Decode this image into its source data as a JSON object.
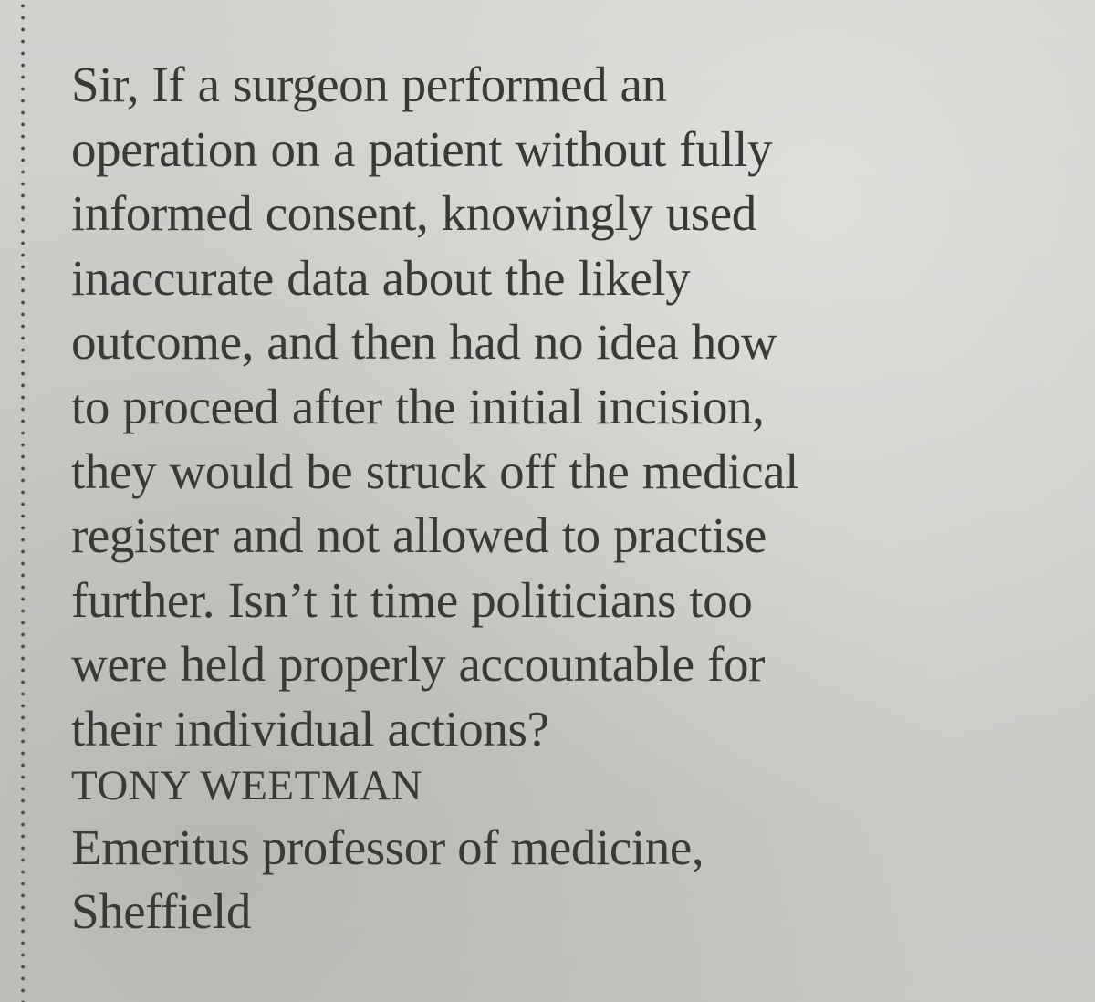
{
  "letter": {
    "lines": [
      "Sir, If a surgeon performed an",
      "operation on a patient without fully",
      "informed consent, knowingly used",
      "inaccurate data about the likely",
      "outcome, and then had no idea how",
      "to proceed after the initial incision,",
      "they would be struck off the medical",
      "register and not allowed to practise",
      "further. Isn’t it time politicians too",
      "were held properly accountable for",
      "their individual actions?"
    ]
  },
  "signature": {
    "name": "TONY WEETMAN",
    "title_lines": [
      "Emeritus professor of medicine,",
      "Sheffield"
    ]
  }
}
